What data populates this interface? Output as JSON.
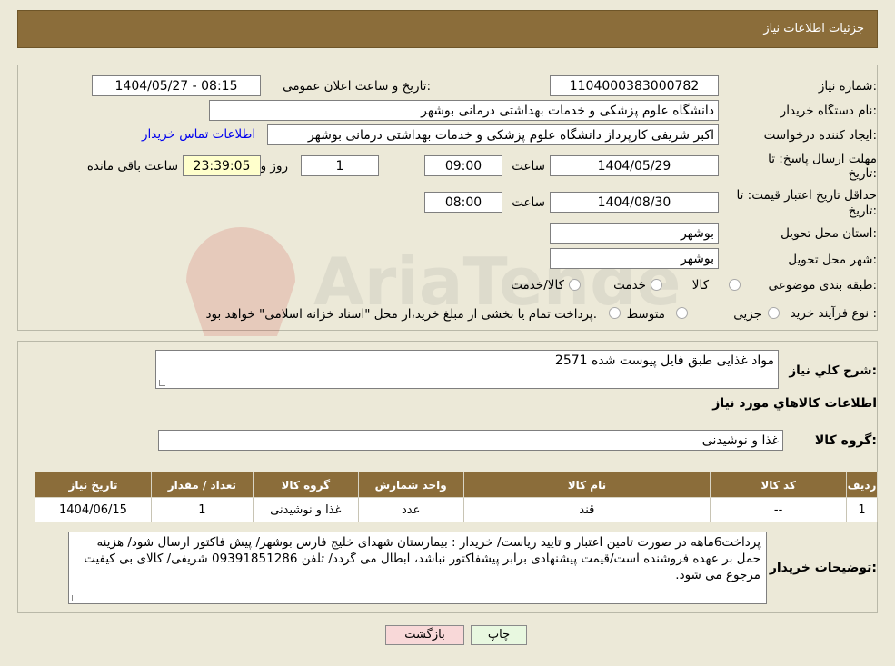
{
  "header": {
    "title": "جزئیات اطلاعات نیاز"
  },
  "form": {
    "need_number_label": "شماره نیاز:",
    "need_number": "1104000383000782",
    "announce_label": "تاریخ و ساعت اعلان عمومی:",
    "announce_value": "1404/05/27 - 08:15",
    "buyer_org_label": "نام دستگاه خریدار:",
    "buyer_org": "دانشگاه علوم پزشکی و خدمات بهداشتی درمانی بوشهر",
    "creator_label": "ایجاد کننده درخواست:",
    "creator": "اکبر شریفی کارپرداز دانشگاه علوم پزشکی و خدمات بهداشتی درمانی بوشهر",
    "contact_link": "اطلاعات تماس خریدار",
    "deadline_label_1": "مهلت ارسال پاسخ: تا",
    "deadline_label_2": "تاریخ:",
    "deadline_date": "1404/05/29",
    "time_label": "ساعت",
    "deadline_time": "09:00",
    "days": "1",
    "days_label": "روز و",
    "remaining": "23:39:05",
    "remaining_label": "ساعت باقی مانده",
    "validity_label_1": "حداقل تاریخ اعتبار قیمت: تا",
    "validity_label_2": "تاریخ:",
    "validity_date": "1404/08/30",
    "validity_time": "08:00",
    "province_label": "استان محل تحویل:",
    "province": "بوشهر",
    "city_label": "شهر محل تحویل:",
    "city": "بوشهر",
    "category_label": "طبقه بندی موضوعی:",
    "category_options": [
      "کالا",
      "خدمت",
      "کالا/خدمت"
    ],
    "process_label": "نوع فرآیند خرید :",
    "process_options": [
      "جزیی",
      "متوسط"
    ],
    "payment_note": "پرداخت تمام یا بخشی از مبلغ خرید،از محل \"اسناد خزانه اسلامی\" خواهد بود."
  },
  "details": {
    "summary_label": "شرح کلي نياز:",
    "summary": "مواد غذایی طبق فایل پیوست شده 2571",
    "goods_info_title": "اطلاعات کالاهاي مورد نياز",
    "group_label": "گروه کالا:",
    "group": "غذا و نوشیدنی",
    "table": {
      "headers": [
        "رديف",
        "کد کالا",
        "نام کالا",
        "واحد شمارش",
        "گروه کالا",
        "تعداد / مقدار",
        "تاريخ نياز"
      ],
      "rows": [
        [
          "1",
          "--",
          "قند",
          "عدد",
          "غذا و نوشیدنی",
          "1",
          "1404/06/15"
        ]
      ]
    },
    "buyer_notes_label": "توضیحات خریدار:",
    "buyer_notes": "پرداخت6ماهه در صورت تامین اعتبار و تایید ریاست/ خریدار : بیمارستان شهدای خلیج فارس بوشهر/ پیش فاکتور ارسال شود/ هزینه حمل بر عهده فروشنده است/قیمت پیشنهادی برابر پیشفاکتور نباشد، ابطال می گردد/ تلفن 09391851286 شریفی/ کالای بی کیفیت مرجوع می شود."
  },
  "buttons": {
    "print": "چاپ",
    "back": "بازگشت"
  },
  "watermark": {
    "text": "AriaTender.neT"
  },
  "colors": {
    "header": "#8b6d3a",
    "background": "#ece9d8",
    "link": "#0000ee",
    "back_button": "#f8d8d8",
    "print_button": "#e8f8e0"
  }
}
